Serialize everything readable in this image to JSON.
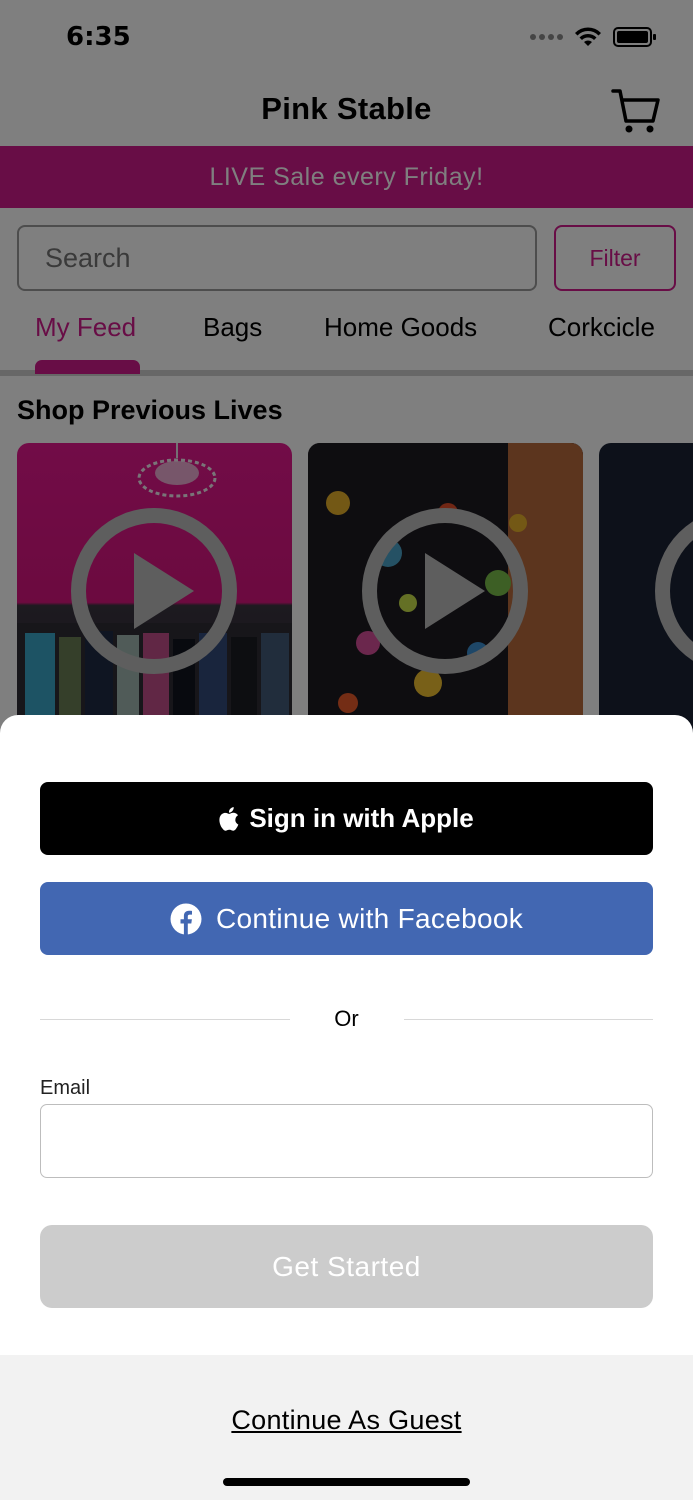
{
  "status_bar": {
    "time": "6:35"
  },
  "nav": {
    "title": "Pink Stable",
    "cart_icon": "cart-icon"
  },
  "banner": {
    "text": "LIVE Sale every Friday!"
  },
  "search": {
    "placeholder": "Search",
    "filter_label": "Filter"
  },
  "tabs": [
    {
      "label": "My Feed",
      "active": true
    },
    {
      "label": "Bags",
      "active": false
    },
    {
      "label": "Home Goods",
      "active": false
    },
    {
      "label": "Corkcicle",
      "active": false
    }
  ],
  "section": {
    "title": "Shop Previous Lives"
  },
  "sheet": {
    "apple_label": "Sign in with Apple",
    "facebook_label": "Continue with Facebook",
    "or_label": "Or",
    "email_label": "Email",
    "email_value": "",
    "get_started_label": "Get Started",
    "guest_label": "Continue As Guest"
  },
  "colors": {
    "brand_pink": "#d11a8c",
    "facebook_blue": "#4267b2",
    "disabled_gray": "#cccccc"
  }
}
